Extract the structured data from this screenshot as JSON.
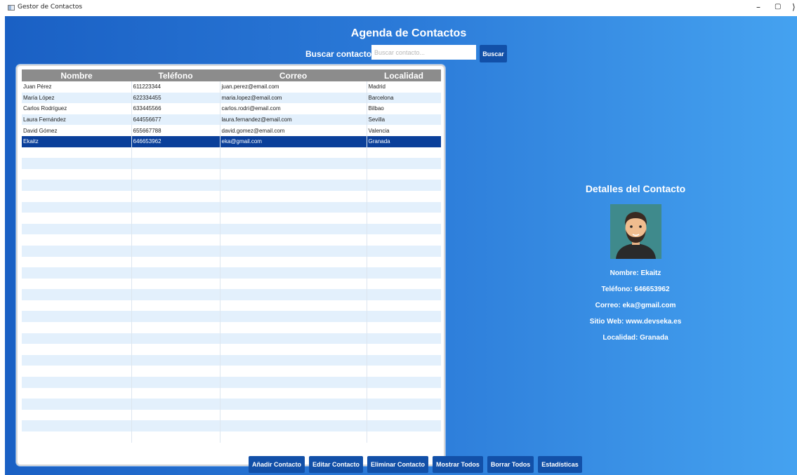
{
  "window": {
    "title": "Gestor de Contactos",
    "minimize": "–",
    "maximize": "▢",
    "close": "⟩"
  },
  "header": {
    "title": "Agenda de Contactos",
    "search_label": "Buscar contacto:",
    "search_placeholder": "Buscar contacto...",
    "search_value": "",
    "search_button": "Buscar"
  },
  "table": {
    "columns": [
      "Nombre",
      "Teléfono",
      "Correo",
      "Localidad"
    ],
    "rows": [
      [
        "Juan Pérez",
        "611223344",
        "juan.perez@email.com",
        "Madrid"
      ],
      [
        "María López",
        "622334455",
        "maria.lopez@email.com",
        "Barcelona"
      ],
      [
        "Carlos Rodríguez",
        "633445566",
        "carlos.rodri@email.com",
        "Bilbao"
      ],
      [
        "Laura Fernández",
        "644556677",
        "laura.fernandez@email.com",
        "Sevilla"
      ],
      [
        "David Gómez",
        "655667788",
        "david.gomez@email.com",
        "Valencia"
      ],
      [
        "Ekaitz",
        "646653962",
        "eka@gmail.com",
        "Granada"
      ]
    ],
    "selected_row": 5,
    "empty_rows": 27
  },
  "details": {
    "title": "Detalles del Contacto",
    "nombre": "Nombre: Ekaitz",
    "telefono": "Teléfono: 646653962",
    "correo": "Correo: eka@gmail.com",
    "web": "Sitio Web: www.devseka.es",
    "localidad": "Localidad: Granada"
  },
  "buttons": {
    "add": "Añadir Contacto",
    "edit": "Editar Contacto",
    "delete": "Eliminar Contacto",
    "show_all": "Mostrar Todos",
    "delete_all": "Borrar Todos",
    "stats": "Estadísticas"
  },
  "colors": {
    "accent": "#1250a8",
    "selected_row": "#0a3f9a",
    "header_bg": "#8c8c8c",
    "alt_row": "#e3f0fc"
  }
}
